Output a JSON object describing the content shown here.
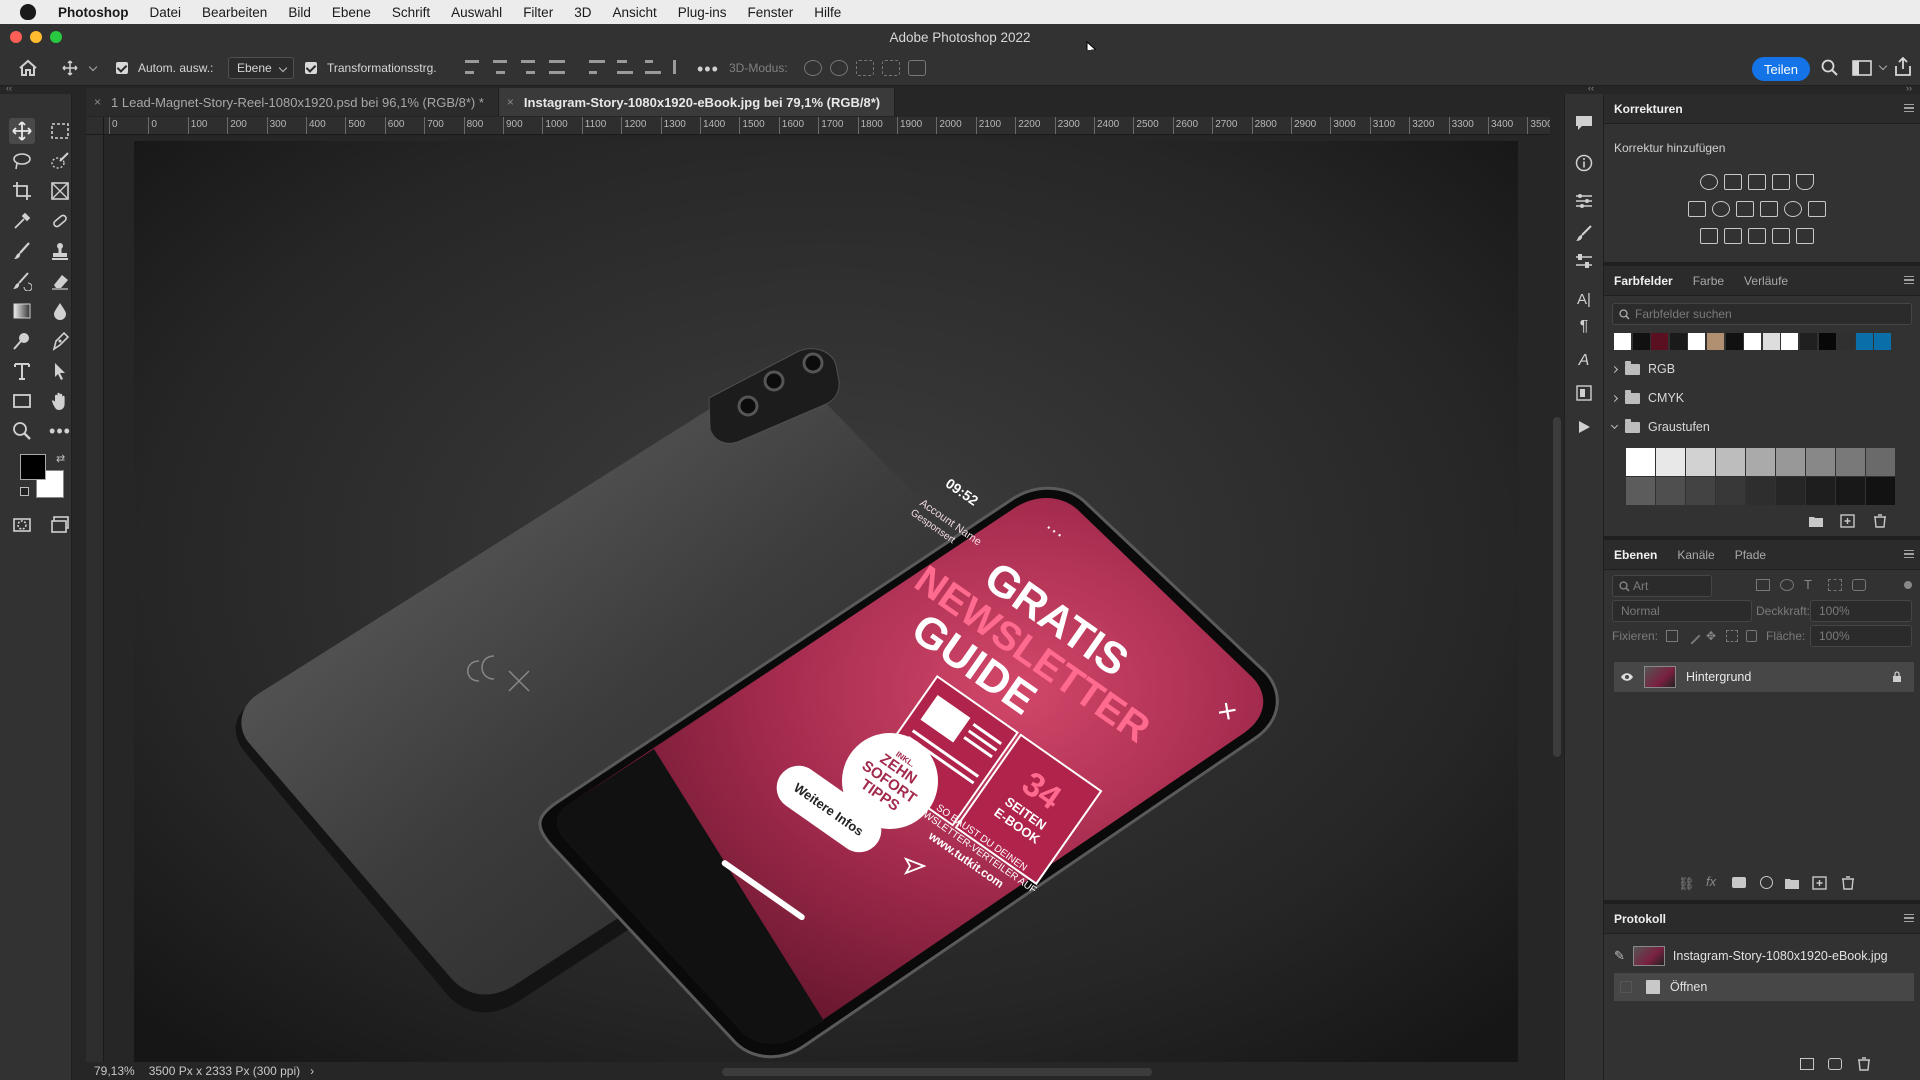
{
  "menubar": {
    "items": [
      "Photoshop",
      "Datei",
      "Bearbeiten",
      "Bild",
      "Ebene",
      "Schrift",
      "Auswahl",
      "Filter",
      "3D",
      "Ansicht",
      "Plug-ins",
      "Fenster",
      "Hilfe"
    ]
  },
  "window": {
    "title": "Adobe Photoshop 2022"
  },
  "options": {
    "auto_select_label": "Autom. ausw.:",
    "auto_select_value": "Ebene",
    "transform_label": "Transformationsstrg.",
    "mode_3d_label": "3D-Modus:",
    "share_label": "Teilen"
  },
  "tabs": [
    {
      "label": "1 Lead-Magnet-Story-Reel-1080x1920.psd bei 96,1% (RGB/8*) *",
      "close": "×"
    },
    {
      "label": "Instagram-Story-1080x1920-eBook.jpg bei 79,1% (RGB/8*)",
      "close": "×"
    }
  ],
  "ruler": {
    "h": [
      "0",
      "0",
      "100",
      "200",
      "300",
      "400",
      "500",
      "600",
      "700",
      "800",
      "900",
      "1000",
      "1100",
      "1200",
      "1300",
      "1400",
      "1500",
      "1600",
      "1700",
      "1800",
      "1900",
      "2000",
      "2100",
      "2200",
      "2300",
      "2400",
      "2500",
      "2600",
      "2700",
      "2800",
      "2900",
      "3000",
      "3100",
      "3200",
      "3300",
      "3400",
      "3500"
    ]
  },
  "canvas": {
    "story": {
      "time": "09:52",
      "account_name": "Account Name",
      "sponsored": "Gesponsert",
      "headline_1": "GRATIS",
      "headline_2": "NEWSLETTER",
      "headline_3": "GUIDE",
      "pages_number": "34",
      "pages_label_1": "SEITEN",
      "pages_label_2": "E-BOOK",
      "body_1": "SO BAUST DU DEINEN",
      "body_2": "NEWSLETTER-VERTEILER AUF",
      "url": "www.tutkit.com",
      "badge_small": "INKL.",
      "badge_1": "ZEHN",
      "badge_2": "SOFORT",
      "badge_3": "TIPPS",
      "cta": "Weitere Infos",
      "close": "×"
    }
  },
  "status": {
    "zoom": "79,13%",
    "doc_info": "3500 Px x 2333 Px (300 ppi)",
    "arrow": "›"
  },
  "panels": {
    "corrections": {
      "title": "Korrekturen",
      "subtitle": "Korrektur hinzufügen"
    },
    "swatches": {
      "tabs": [
        "Farbfelder",
        "Farbe",
        "Verläufe"
      ],
      "search_placeholder": "Farbfelder suchen",
      "colors": [
        "#ffffff",
        "#111111",
        "#5a1020",
        "#1a1a1a",
        "#ffffff",
        "#b09070",
        "#111111",
        "#ffffff",
        "#dddddd",
        "#ffffff",
        "#202020",
        "#080808",
        "#303030",
        "#0a6ea8",
        "#0a6ea8"
      ],
      "groups": [
        "RGB",
        "CMYK",
        "Graustufen"
      ],
      "grays": [
        "#ffffff",
        "#e8e8e8",
        "#d2d2d2",
        "#bdbdbd",
        "#aaaaaa",
        "#989898",
        "#888888",
        "#797979",
        "#6a6a6a",
        "#5c5c5c",
        "#4f4f4f",
        "#434343",
        "#383838",
        "#2e2e2e",
        "#262626",
        "#1e1e1e",
        "#181818",
        "#121212"
      ]
    },
    "layers": {
      "tabs": [
        "Ebenen",
        "Kanäle",
        "Pfade"
      ],
      "filter_label": "Art",
      "blend_mode": "Normal",
      "opacity_label": "Deckkraft:",
      "opacity_value": "100%",
      "lock_label": "Fixieren:",
      "fill_label": "Fläche:",
      "fill_value": "100%",
      "items": [
        {
          "name": "Hintergrund"
        }
      ]
    },
    "history": {
      "title": "Protokoll",
      "snapshot": "Instagram-Story-1080x1920-eBook.jpg",
      "steps": [
        "Öffnen"
      ]
    }
  }
}
